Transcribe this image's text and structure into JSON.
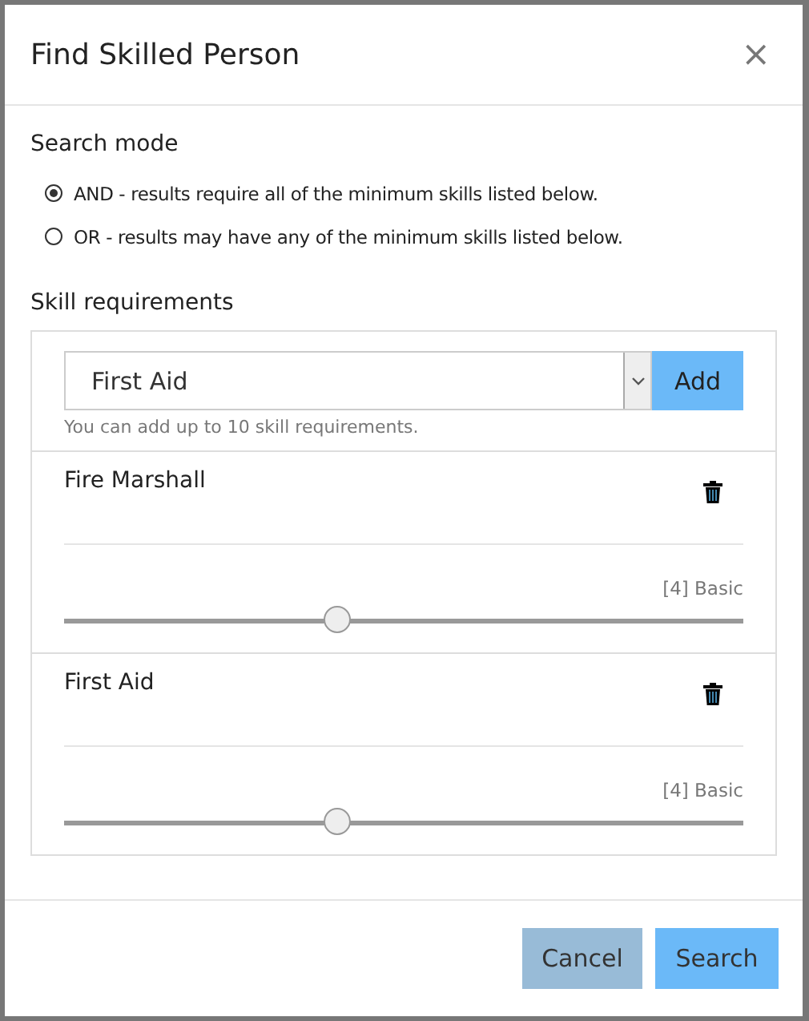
{
  "dialog": {
    "title": "Find Skilled Person",
    "close": "×"
  },
  "search_mode": {
    "label": "Search mode",
    "options": [
      {
        "label": "AND - results require all of the minimum skills listed below.",
        "selected": true
      },
      {
        "label": "OR - results may have any of the minimum skills listed below.",
        "selected": false
      }
    ]
  },
  "skills": {
    "label": "Skill requirements",
    "select_value": "First Aid",
    "add_button": "Add",
    "hint": "You can add up to 10 skill requirements.",
    "items": [
      {
        "name": "Fire Marshall",
        "reading": "[4] Basic",
        "level": 0.404
      },
      {
        "name": "First Aid",
        "reading": "[4] Basic",
        "level": 0.404
      }
    ]
  },
  "buttons": [
    {
      "label": "Cancel",
      "kind": "secondary"
    },
    {
      "label": "Search",
      "kind": "primary"
    }
  ]
}
